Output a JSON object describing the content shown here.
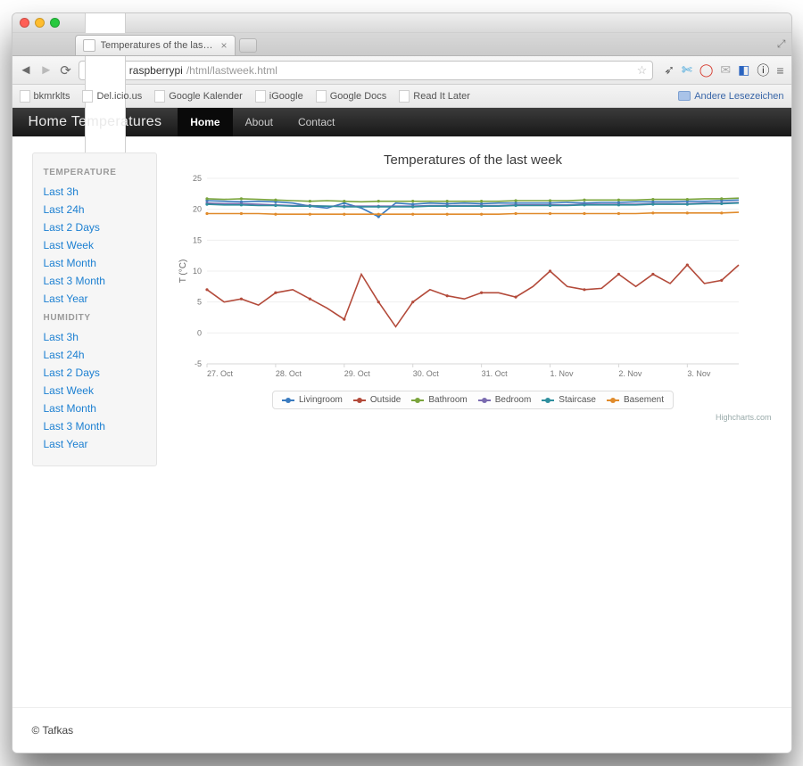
{
  "window": {
    "tab_title": "Temperatures of the last We…",
    "url_host": "raspberrypi",
    "url_path": "/html/lastweek.html",
    "other_bookmarks": "Andere Lesezeichen"
  },
  "bookmarks": [
    "bkmrklts",
    "Del.icio.us",
    "Google Kalender",
    "iGoogle",
    "Google Docs",
    "Read It Later"
  ],
  "nav": {
    "brand": "Home Temperatures",
    "items": [
      {
        "label": "Home",
        "active": true
      },
      {
        "label": "About",
        "active": false
      },
      {
        "label": "Contact",
        "active": false
      }
    ]
  },
  "sidebar": {
    "sections": [
      {
        "title": "TEMPERATURE",
        "links": [
          "Last 3h",
          "Last 24h",
          "Last 2 Days",
          "Last Week",
          "Last Month",
          "Last 3 Month",
          "Last Year"
        ]
      },
      {
        "title": "HUMIDITY",
        "links": [
          "Last 3h",
          "Last 24h",
          "Last 2 Days",
          "Last Week",
          "Last Month",
          "Last 3 Month",
          "Last Year"
        ]
      }
    ]
  },
  "chart": {
    "title": "Temperatures of the last week",
    "credit": "Highcharts.com"
  },
  "footer": "© Tafkas",
  "chart_data": {
    "type": "line",
    "ylabel": "T (°C)",
    "ylim": [
      -5,
      25
    ],
    "yticks": [
      -5,
      0,
      5,
      10,
      15,
      20,
      25
    ],
    "x": [
      0,
      1,
      2,
      3,
      4,
      5,
      6,
      7,
      8,
      9,
      10,
      11,
      12,
      13,
      14,
      15,
      16,
      17,
      18,
      19,
      20,
      21,
      22,
      23,
      24,
      25,
      26,
      27,
      28,
      29,
      30,
      31
    ],
    "xtick_idx": [
      0,
      4,
      8,
      12,
      16,
      20,
      24,
      28
    ],
    "xtick_labels": [
      "27. Oct",
      "28. Oct",
      "29. Oct",
      "30. Oct",
      "31. Oct",
      "1. Nov",
      "2. Nov",
      "3. Nov"
    ],
    "series": [
      {
        "name": "Livingroom",
        "color": "#3a7bbf",
        "values": [
          21.4,
          21.3,
          21.2,
          21.3,
          21.2,
          21.0,
          20.5,
          20.2,
          21.0,
          20.2,
          18.8,
          21.0,
          20.8,
          21.0,
          20.9,
          21.0,
          20.9,
          21.0,
          21.0,
          21.0,
          21.0,
          21.1,
          21.0,
          21.1,
          21.1,
          21.2,
          21.2,
          21.2,
          21.3,
          21.3,
          21.4,
          21.5
        ]
      },
      {
        "name": "Outside",
        "color": "#b34a3a",
        "values": [
          7.0,
          5.0,
          5.5,
          4.5,
          6.5,
          7.0,
          5.5,
          4.0,
          2.2,
          9.5,
          5.0,
          1.0,
          5.0,
          7.0,
          6.0,
          5.5,
          6.5,
          6.5,
          5.8,
          7.5,
          10.0,
          7.5,
          7.0,
          7.2,
          9.5,
          7.5,
          9.5,
          8.0,
          11.0,
          8.0,
          8.5,
          11.0
        ]
      },
      {
        "name": "Bathroom",
        "color": "#7aa43c",
        "values": [
          21.7,
          21.6,
          21.7,
          21.6,
          21.5,
          21.4,
          21.3,
          21.4,
          21.3,
          21.2,
          21.3,
          21.3,
          21.3,
          21.3,
          21.3,
          21.3,
          21.3,
          21.3,
          21.4,
          21.4,
          21.4,
          21.4,
          21.5,
          21.5,
          21.5,
          21.5,
          21.6,
          21.6,
          21.6,
          21.7,
          21.7,
          21.8
        ]
      },
      {
        "name": "Bedroom",
        "color": "#7a6bb0",
        "values": [
          21.0,
          20.9,
          20.9,
          20.8,
          20.7,
          20.6,
          20.6,
          20.5,
          20.5,
          20.5,
          20.5,
          20.5,
          20.5,
          20.6,
          20.6,
          20.6,
          20.6,
          20.6,
          20.7,
          20.7,
          20.7,
          20.7,
          20.8,
          20.8,
          20.8,
          20.8,
          20.9,
          20.9,
          20.9,
          21.0,
          21.0,
          21.1
        ]
      },
      {
        "name": "Staircase",
        "color": "#2f8f9e",
        "values": [
          20.8,
          20.7,
          20.7,
          20.6,
          20.6,
          20.5,
          20.5,
          20.5,
          20.4,
          20.4,
          20.4,
          20.4,
          20.4,
          20.5,
          20.5,
          20.5,
          20.5,
          20.5,
          20.6,
          20.6,
          20.6,
          20.6,
          20.7,
          20.7,
          20.7,
          20.7,
          20.8,
          20.8,
          20.8,
          20.9,
          20.9,
          21.0
        ]
      },
      {
        "name": "Basement",
        "color": "#e08b2c",
        "values": [
          19.3,
          19.3,
          19.3,
          19.3,
          19.2,
          19.2,
          19.2,
          19.2,
          19.2,
          19.2,
          19.2,
          19.2,
          19.2,
          19.2,
          19.2,
          19.2,
          19.2,
          19.2,
          19.3,
          19.3,
          19.3,
          19.3,
          19.3,
          19.3,
          19.3,
          19.3,
          19.4,
          19.4,
          19.4,
          19.4,
          19.4,
          19.5
        ]
      }
    ]
  }
}
